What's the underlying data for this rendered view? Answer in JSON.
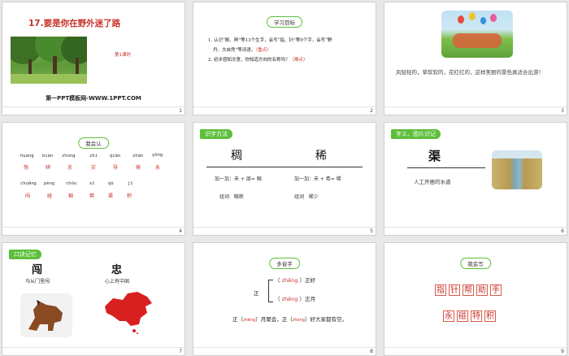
{
  "slides": [
    {
      "number": "1",
      "title": "17.要是你在野外迷了路",
      "tag": "第1课时",
      "footer": "第一PPT模板网-WWW.1PPT.COM"
    },
    {
      "number": "2",
      "pill": "学习目标",
      "goals": [
        "1. 认识“枫、辨”等13个生字，会写“指、针”等9个字，会写“野",
        "丹、大自然”等词语。",
        "2. 初步感知文意，你知道方向的名称吗？"
      ],
      "goal_tag": "（重点）",
      "goal_tag2": "（难点）"
    },
    {
      "number": "3",
      "text": "风轻轻的，草软软的，花红红的，这样美丽的景色真适合出游！"
    },
    {
      "number": "4",
      "pill": "我会认",
      "row1_pinyin": [
        "huang",
        "biàn",
        "zhong",
        "shí",
        "qiāo",
        "zhān",
        "yǒng"
      ],
      "row1_han": [
        "恍",
        "辨",
        "忠",
        "实",
        "导",
        "鼎",
        "永"
      ],
      "row2_pinyin": [
        "chuǎng",
        "pèng",
        "chóu",
        "xī",
        "qū",
        "jī"
      ],
      "row2_han": [
        "闯",
        "碰",
        "稠",
        "稀",
        "渠",
        "积"
      ]
    },
    {
      "number": "5",
      "tag": "识字方法",
      "char1": "稠",
      "char2": "稀",
      "eq1": "加一加：禾 + 周= 稠",
      "eq2": "加一加：禾 + 希= 稀",
      "word1": "组词   稠密",
      "word2": "组词   稀少"
    },
    {
      "number": "6",
      "tag": "字义、图片识记",
      "char": "渠",
      "meaning": "人工开凿的水道"
    },
    {
      "number": "7",
      "tag": "口诀记忆",
      "char1": "闯",
      "tip1": "马从门里闯",
      "char2": "忠",
      "tip2": "心上有中国"
    },
    {
      "number": "8",
      "pill": "多音字",
      "char": "正",
      "r1_py": "zhēng",
      "r1_word": "正好",
      "r2_py": "zhēng",
      "r2_word": "正月",
      "sentence_a": "正（",
      "s_py1": "zhēng",
      "sentence_b": "）月聚会，正（",
      "s_py2": "zhèng",
      "sentence_c": "）好大家都有空。"
    },
    {
      "number": "9",
      "pill": "我会写",
      "row1": [
        "指",
        "针",
        "帮",
        "助",
        "手"
      ],
      "row2": [
        "永",
        "碰",
        "特",
        "积"
      ]
    }
  ],
  "colors": {
    "accent": "#5cbf3a",
    "red": "#c8312a"
  }
}
